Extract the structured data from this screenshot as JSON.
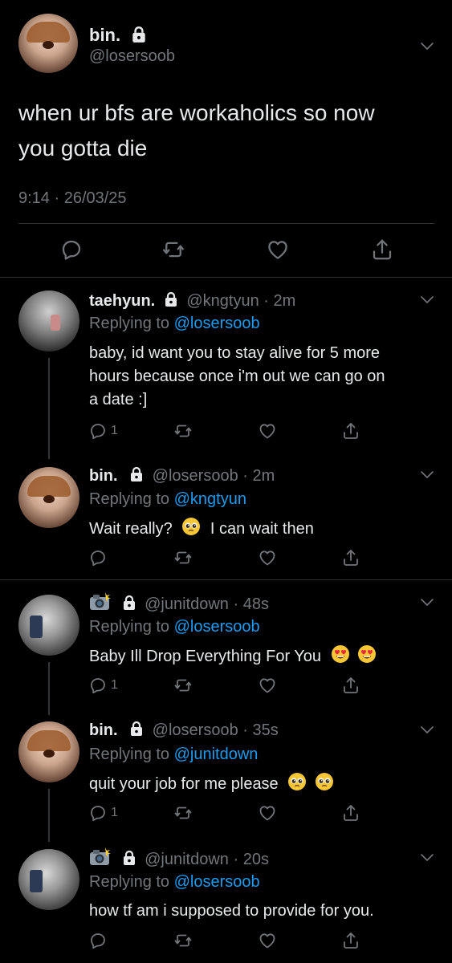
{
  "main_tweet": {
    "display_name": "bin.",
    "handle": "@losersoob",
    "text_line1": "when ur bfs are workaholics so now",
    "text_line2": "you gotta die",
    "timestamp": "9:14 · 26/03/25"
  },
  "replies": [
    {
      "display_name": "taehyun.",
      "handle": "@kngtyun",
      "time": "· 2m",
      "replying_prefix": "Replying to",
      "replying_to": "@losersoob",
      "lines": [
        "baby, id want you to stay alive for 5 more",
        "hours because once i'm out we can go on",
        "a date :]"
      ],
      "reply_count": "1"
    },
    {
      "display_name": "bin.",
      "handle": "@losersoob",
      "time": "· 2m",
      "replying_prefix": "Replying to",
      "replying_to": "@kngtyun",
      "text_before": "Wait really?",
      "text_after": "I can wait then",
      "reply_count": ""
    },
    {
      "display_name": "",
      "handle": "@junitdown",
      "time": "· 48s",
      "replying_prefix": "Replying to",
      "replying_to": "@losersoob",
      "text": "Baby Ill Drop Everything For You",
      "reply_count": "1"
    },
    {
      "display_name": "bin.",
      "handle": "@losersoob",
      "time": "· 35s",
      "replying_prefix": "Replying to",
      "replying_to": "@junitdown",
      "text": "quit your job for me please",
      "reply_count": "1"
    },
    {
      "display_name": "",
      "handle": "@junitdown",
      "time": "· 20s",
      "replying_prefix": "Replying to",
      "replying_to": "@losersoob",
      "text": "how tf am i supposed to provide for you.",
      "reply_count": ""
    }
  ],
  "icons": {
    "reply": "reply-icon",
    "retweet": "retweet-icon",
    "like": "like-icon",
    "share": "share-icon",
    "lock": "lock-icon",
    "chevron": "chevron-down-icon",
    "camera_emoji": "camera-flash-emoji",
    "pleading_emoji": "pleading-face-emoji",
    "heart_eyes_emoji": "heart-eyes-emoji"
  },
  "colors": {
    "background": "#000000",
    "text": "#e7e9ea",
    "secondary": "#71767b",
    "link": "#1d9bf0",
    "divider": "#2f3336"
  }
}
